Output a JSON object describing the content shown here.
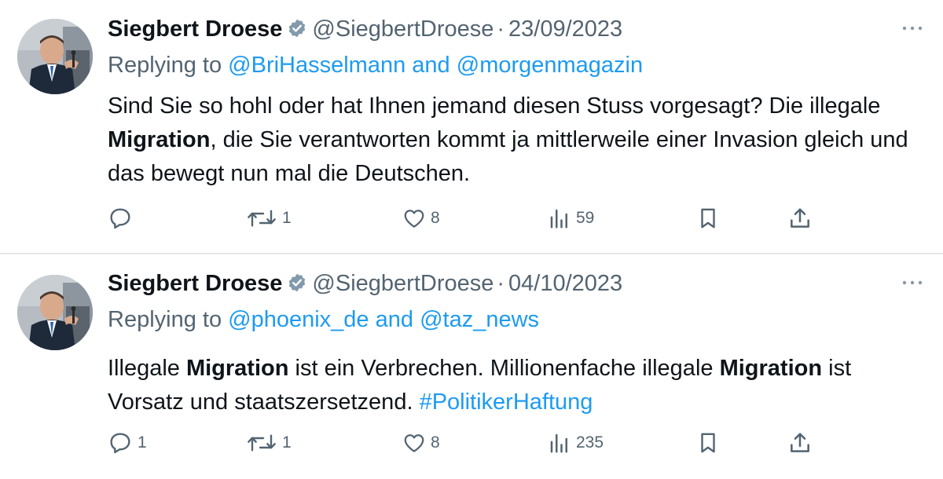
{
  "tweets": [
    {
      "author_name": "Siegbert Droese",
      "handle": "@SiegbertDroese",
      "separator": "·",
      "date": "23/09/2023",
      "replying_prefix": "Replying to",
      "reply_mention_1": "@BriHasselmann",
      "reply_and": "and",
      "reply_mention_2": "@morgenmagazin",
      "body_1": "Sind Sie so hohl oder hat Ihnen jemand diesen Stuss vorgesagt? Die illegale ",
      "body_bold_1": "Migration",
      "body_2": ", die Sie verantworten kommt ja mittlerweile einer Invasion gleich und das bewegt nun mal die Deutschen.",
      "replies": "",
      "reposts": "1",
      "likes": "8",
      "views": "59",
      "icons": [
        "verified-badge-icon",
        "more-icon",
        "reply-icon",
        "repost-icon",
        "like-icon",
        "views-icon",
        "bookmark-icon",
        "share-icon"
      ]
    },
    {
      "author_name": "Siegbert Droese",
      "handle": "@SiegbertDroese",
      "separator": "·",
      "date": "04/10/2023",
      "replying_prefix": "Replying to",
      "reply_mention_1": "@phoenix_de",
      "reply_and": "and",
      "reply_mention_2": "@taz_news",
      "body_1": "Illegale ",
      "body_bold_1": "Migration",
      "body_2": " ist ein Verbrechen. Millionenfache illegale ",
      "body_bold_2": "Migration",
      "body_3": " ist Vorsatz und staatszersetzend. ",
      "hashtag": "#PolitikerHaftung",
      "replies": "1",
      "reposts": "1",
      "likes": "8",
      "views": "235",
      "icons": [
        "verified-badge-icon",
        "more-icon",
        "reply-icon",
        "repost-icon",
        "like-icon",
        "views-icon",
        "bookmark-icon",
        "share-icon"
      ]
    }
  ],
  "colors": {
    "text": "#0f1419",
    "secondary": "#536471",
    "link": "#1d9bf0",
    "divider": "#e3e6e9"
  }
}
